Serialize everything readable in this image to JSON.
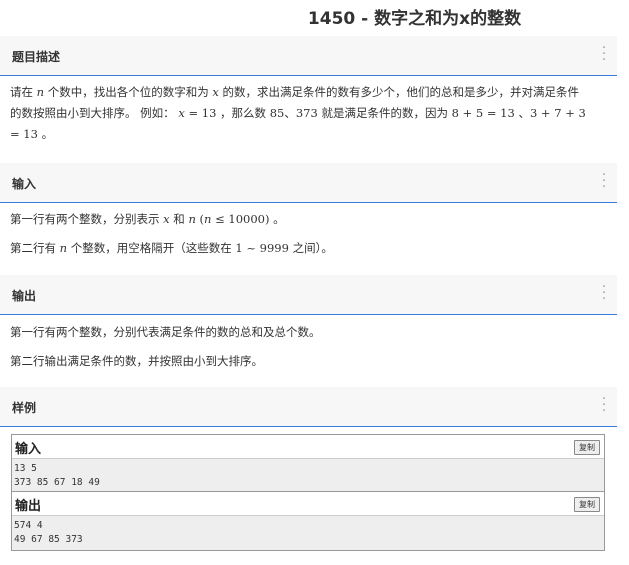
{
  "page_title": "1450 - 数字之和为x的整数",
  "sections": {
    "description": {
      "label": "题目描述",
      "line1a": "请在 ",
      "var_n": "n",
      "line1b": " 个数中，找出各个位的数字和为 ",
      "var_x": "x",
      "line1c": " 的数，求出满足条件的数有多少个，他们的总和是多少，并对满足条件",
      "line2a": "的数按照由小到大排序。 例如： ",
      "ex_x": "x",
      "ex_eq": " = 13",
      "line2b": " ，那么数 ",
      "ex_nums": "85、373",
      "line2c": " 就是满足条件的数，因为 ",
      "ex_sum1": "8 + 5 = 13",
      "line2d": " 、",
      "ex_sum2a": "3 + 7 + 3",
      "ex_sum2b": "= 13",
      "line3c": " 。"
    },
    "input": {
      "label": "输入",
      "p1a": "第一行有两个整数，分别表示 ",
      "p1_x": "x",
      "p1_and": " 和 ",
      "p1_n": "n",
      "p1_cond_open": "  (",
      "p1_cond_n": "n",
      "p1_cond_rest": " ≤ 10000)",
      "p1_end": " 。",
      "p2a": "第二行有 ",
      "p2_n": "n",
      "p2b": " 个整数，用空格隔开（这些数在 ",
      "p2_range": "1 ~ 9999",
      "p2c": " 之间）。"
    },
    "output": {
      "label": "输出",
      "p1": "第一行有两个整数，分别代表满足条件的数的总和及总个数。",
      "p2": "第二行输出满足条件的数，并按照由小到大排序。"
    },
    "sample": {
      "label": "样例"
    }
  },
  "sample_input": {
    "label": "输入",
    "copy_label": "复制",
    "line1": "13 5",
    "line2": "373 85 67 18 49"
  },
  "sample_output": {
    "label": "输出",
    "copy_label": "复制",
    "line1": "574 4",
    "line2": "49 67 85 373"
  },
  "icons": {
    "menu": "more-vertical-icon"
  },
  "colors": {
    "accent_line": "#3a7bd5",
    "header_bg": "#f7f7f7",
    "sample_body_bg": "#eeeeee"
  }
}
